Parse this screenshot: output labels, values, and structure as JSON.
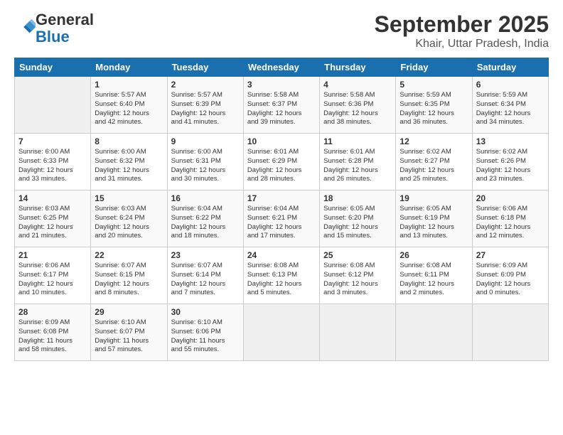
{
  "logo": {
    "line1": "General",
    "line2": "Blue"
  },
  "title": "September 2025",
  "subtitle": "Khair, Uttar Pradesh, India",
  "headers": [
    "Sunday",
    "Monday",
    "Tuesday",
    "Wednesday",
    "Thursday",
    "Friday",
    "Saturday"
  ],
  "weeks": [
    [
      {
        "day": "",
        "info": ""
      },
      {
        "day": "1",
        "info": "Sunrise: 5:57 AM\nSunset: 6:40 PM\nDaylight: 12 hours\nand 42 minutes."
      },
      {
        "day": "2",
        "info": "Sunrise: 5:57 AM\nSunset: 6:39 PM\nDaylight: 12 hours\nand 41 minutes."
      },
      {
        "day": "3",
        "info": "Sunrise: 5:58 AM\nSunset: 6:37 PM\nDaylight: 12 hours\nand 39 minutes."
      },
      {
        "day": "4",
        "info": "Sunrise: 5:58 AM\nSunset: 6:36 PM\nDaylight: 12 hours\nand 38 minutes."
      },
      {
        "day": "5",
        "info": "Sunrise: 5:59 AM\nSunset: 6:35 PM\nDaylight: 12 hours\nand 36 minutes."
      },
      {
        "day": "6",
        "info": "Sunrise: 5:59 AM\nSunset: 6:34 PM\nDaylight: 12 hours\nand 34 minutes."
      }
    ],
    [
      {
        "day": "7",
        "info": "Sunrise: 6:00 AM\nSunset: 6:33 PM\nDaylight: 12 hours\nand 33 minutes."
      },
      {
        "day": "8",
        "info": "Sunrise: 6:00 AM\nSunset: 6:32 PM\nDaylight: 12 hours\nand 31 minutes."
      },
      {
        "day": "9",
        "info": "Sunrise: 6:00 AM\nSunset: 6:31 PM\nDaylight: 12 hours\nand 30 minutes."
      },
      {
        "day": "10",
        "info": "Sunrise: 6:01 AM\nSunset: 6:29 PM\nDaylight: 12 hours\nand 28 minutes."
      },
      {
        "day": "11",
        "info": "Sunrise: 6:01 AM\nSunset: 6:28 PM\nDaylight: 12 hours\nand 26 minutes."
      },
      {
        "day": "12",
        "info": "Sunrise: 6:02 AM\nSunset: 6:27 PM\nDaylight: 12 hours\nand 25 minutes."
      },
      {
        "day": "13",
        "info": "Sunrise: 6:02 AM\nSunset: 6:26 PM\nDaylight: 12 hours\nand 23 minutes."
      }
    ],
    [
      {
        "day": "14",
        "info": "Sunrise: 6:03 AM\nSunset: 6:25 PM\nDaylight: 12 hours\nand 21 minutes."
      },
      {
        "day": "15",
        "info": "Sunrise: 6:03 AM\nSunset: 6:24 PM\nDaylight: 12 hours\nand 20 minutes."
      },
      {
        "day": "16",
        "info": "Sunrise: 6:04 AM\nSunset: 6:22 PM\nDaylight: 12 hours\nand 18 minutes."
      },
      {
        "day": "17",
        "info": "Sunrise: 6:04 AM\nSunset: 6:21 PM\nDaylight: 12 hours\nand 17 minutes."
      },
      {
        "day": "18",
        "info": "Sunrise: 6:05 AM\nSunset: 6:20 PM\nDaylight: 12 hours\nand 15 minutes."
      },
      {
        "day": "19",
        "info": "Sunrise: 6:05 AM\nSunset: 6:19 PM\nDaylight: 12 hours\nand 13 minutes."
      },
      {
        "day": "20",
        "info": "Sunrise: 6:06 AM\nSunset: 6:18 PM\nDaylight: 12 hours\nand 12 minutes."
      }
    ],
    [
      {
        "day": "21",
        "info": "Sunrise: 6:06 AM\nSunset: 6:17 PM\nDaylight: 12 hours\nand 10 minutes."
      },
      {
        "day": "22",
        "info": "Sunrise: 6:07 AM\nSunset: 6:15 PM\nDaylight: 12 hours\nand 8 minutes."
      },
      {
        "day": "23",
        "info": "Sunrise: 6:07 AM\nSunset: 6:14 PM\nDaylight: 12 hours\nand 7 minutes."
      },
      {
        "day": "24",
        "info": "Sunrise: 6:08 AM\nSunset: 6:13 PM\nDaylight: 12 hours\nand 5 minutes."
      },
      {
        "day": "25",
        "info": "Sunrise: 6:08 AM\nSunset: 6:12 PM\nDaylight: 12 hours\nand 3 minutes."
      },
      {
        "day": "26",
        "info": "Sunrise: 6:08 AM\nSunset: 6:11 PM\nDaylight: 12 hours\nand 2 minutes."
      },
      {
        "day": "27",
        "info": "Sunrise: 6:09 AM\nSunset: 6:09 PM\nDaylight: 12 hours\nand 0 minutes."
      }
    ],
    [
      {
        "day": "28",
        "info": "Sunrise: 6:09 AM\nSunset: 6:08 PM\nDaylight: 11 hours\nand 58 minutes."
      },
      {
        "day": "29",
        "info": "Sunrise: 6:10 AM\nSunset: 6:07 PM\nDaylight: 11 hours\nand 57 minutes."
      },
      {
        "day": "30",
        "info": "Sunrise: 6:10 AM\nSunset: 6:06 PM\nDaylight: 11 hours\nand 55 minutes."
      },
      {
        "day": "",
        "info": ""
      },
      {
        "day": "",
        "info": ""
      },
      {
        "day": "",
        "info": ""
      },
      {
        "day": "",
        "info": ""
      }
    ]
  ]
}
